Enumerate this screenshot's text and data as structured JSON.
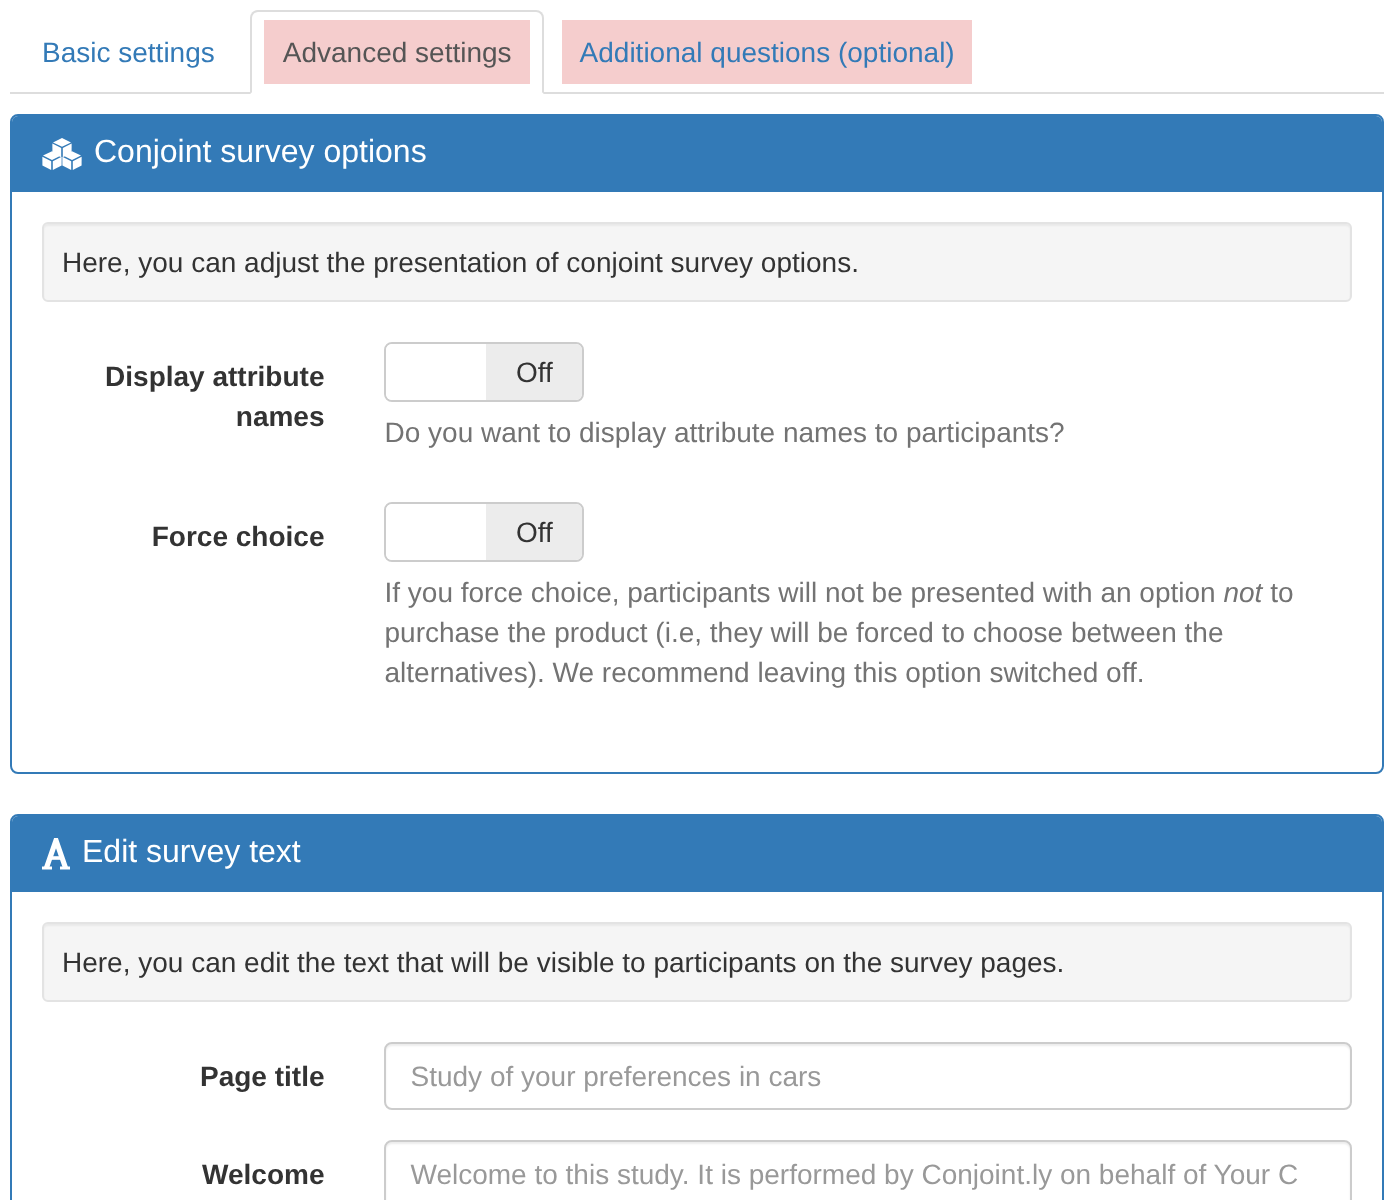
{
  "tabs": [
    {
      "label": "Basic settings",
      "selected": false,
      "highlighted": false
    },
    {
      "label": "Advanced settings",
      "selected": true,
      "highlighted": true
    },
    {
      "label": "Additional questions (optional)",
      "selected": false,
      "highlighted": true
    }
  ],
  "panels": [
    {
      "kind": "options",
      "title": "Conjoint survey options",
      "intro": "Here, you can adjust the presentation of conjoint survey options.",
      "fields": [
        {
          "kind": "toggle",
          "label": "Display attribute names",
          "toggle": {
            "on": false,
            "text": "Off"
          },
          "help": "Do you want to display attribute names to participants?"
        },
        {
          "kind": "toggle",
          "label": "Force choice",
          "toggle": {
            "on": false,
            "text": "Off"
          },
          "help": "If you force choice, participants will not be presented with an option *not* to purchase the product (i.e, they will be forced to choose between the alternatives). We recommend leaving this option switched off."
        }
      ]
    },
    {
      "kind": "text",
      "title": "Edit survey text",
      "intro": "Here, you can edit the text that will be visible to participants on the survey pages.",
      "fields": [
        {
          "kind": "text",
          "label": "Page title",
          "placeholder": "Study of your preferences in cars"
        },
        {
          "kind": "text",
          "label": "Welcome",
          "placeholder": "Welcome to this study. It is performed by Conjoint.ly on behalf of Your C"
        }
      ]
    }
  ]
}
